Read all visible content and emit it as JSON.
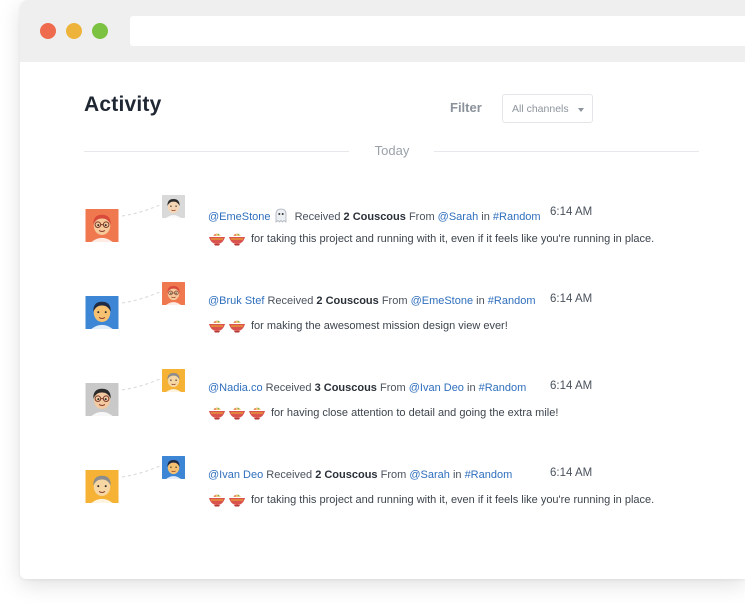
{
  "header": {
    "title": "Activity",
    "filter_label": "Filter",
    "filter_select": {
      "selected": "All channels"
    }
  },
  "divider": {
    "label": "Today"
  },
  "activity": [
    {
      "recipient": "@EmeStone",
      "recipient_icon": "ghost-icon",
      "received": "Received",
      "amount": "2 Couscous",
      "from": "From",
      "sender": "@Sarah",
      "in": "in",
      "channel": "#Random",
      "time": "6:14 AM",
      "couscous_count": 2,
      "message": "for taking this project and running with it, even if it feels like you're running in place.",
      "avatar_big": {
        "bg": "#f0784e",
        "hair": "#d94a3a",
        "skin": "#f6c89a",
        "glasses": true
      },
      "avatar_small": {
        "bg": "#d9d9d9",
        "hair": "#2b2b2b",
        "skin": "#f6d7b5",
        "glasses": false
      }
    },
    {
      "recipient": "@Bruk Stef",
      "received": "Received",
      "amount": "2 Couscous",
      "from": "From",
      "sender": "@EmeStone",
      "in": "in",
      "channel": "#Random",
      "time": "6:14 AM",
      "couscous_count": 2,
      "message": "for making the awesomest mission design view ever!",
      "avatar_big": {
        "bg": "#3d86d6",
        "hair": "#1f2a44",
        "skin": "#f6c271",
        "glasses": false
      },
      "avatar_small": {
        "bg": "#f0784e",
        "hair": "#d94a3a",
        "skin": "#f6c89a",
        "glasses": true
      }
    },
    {
      "recipient": "@Nadia.co",
      "received": "Received",
      "amount": "3 Couscous",
      "from": "From",
      "sender": "@Ivan Deo",
      "in": "in",
      "channel": "#Random",
      "time": "6:14 AM",
      "couscous_count": 3,
      "message": "for having close attention to detail and going the extra mile!",
      "avatar_big": {
        "bg": "#c9c9c9",
        "hair": "#2b2b2b",
        "skin": "#f2c9a0",
        "glasses": true
      },
      "avatar_small": {
        "bg": "#f5b234",
        "hair": "#8c8c8c",
        "skin": "#f6d7a3",
        "glasses": false
      }
    },
    {
      "recipient": "@Ivan Deo",
      "received": "Received",
      "amount": "2 Couscous",
      "from": "From",
      "sender": "@Sarah",
      "in": "in",
      "channel": "#Random",
      "time": "6:14 AM",
      "couscous_count": 2,
      "message": "for taking this project and running with it, even if it feels like you're running in place.",
      "avatar_big": {
        "bg": "#f5b234",
        "hair": "#8c8c8c",
        "skin": "#f6d7a3",
        "glasses": false
      },
      "avatar_small": {
        "bg": "#3d86d6",
        "hair": "#1f2a44",
        "skin": "#f6c271",
        "glasses": false
      }
    }
  ],
  "colors": {
    "link": "#2f6fbd",
    "dot_red": "#ee6b4d",
    "dot_yellow": "#eeb33a",
    "dot_green": "#7cc242"
  }
}
